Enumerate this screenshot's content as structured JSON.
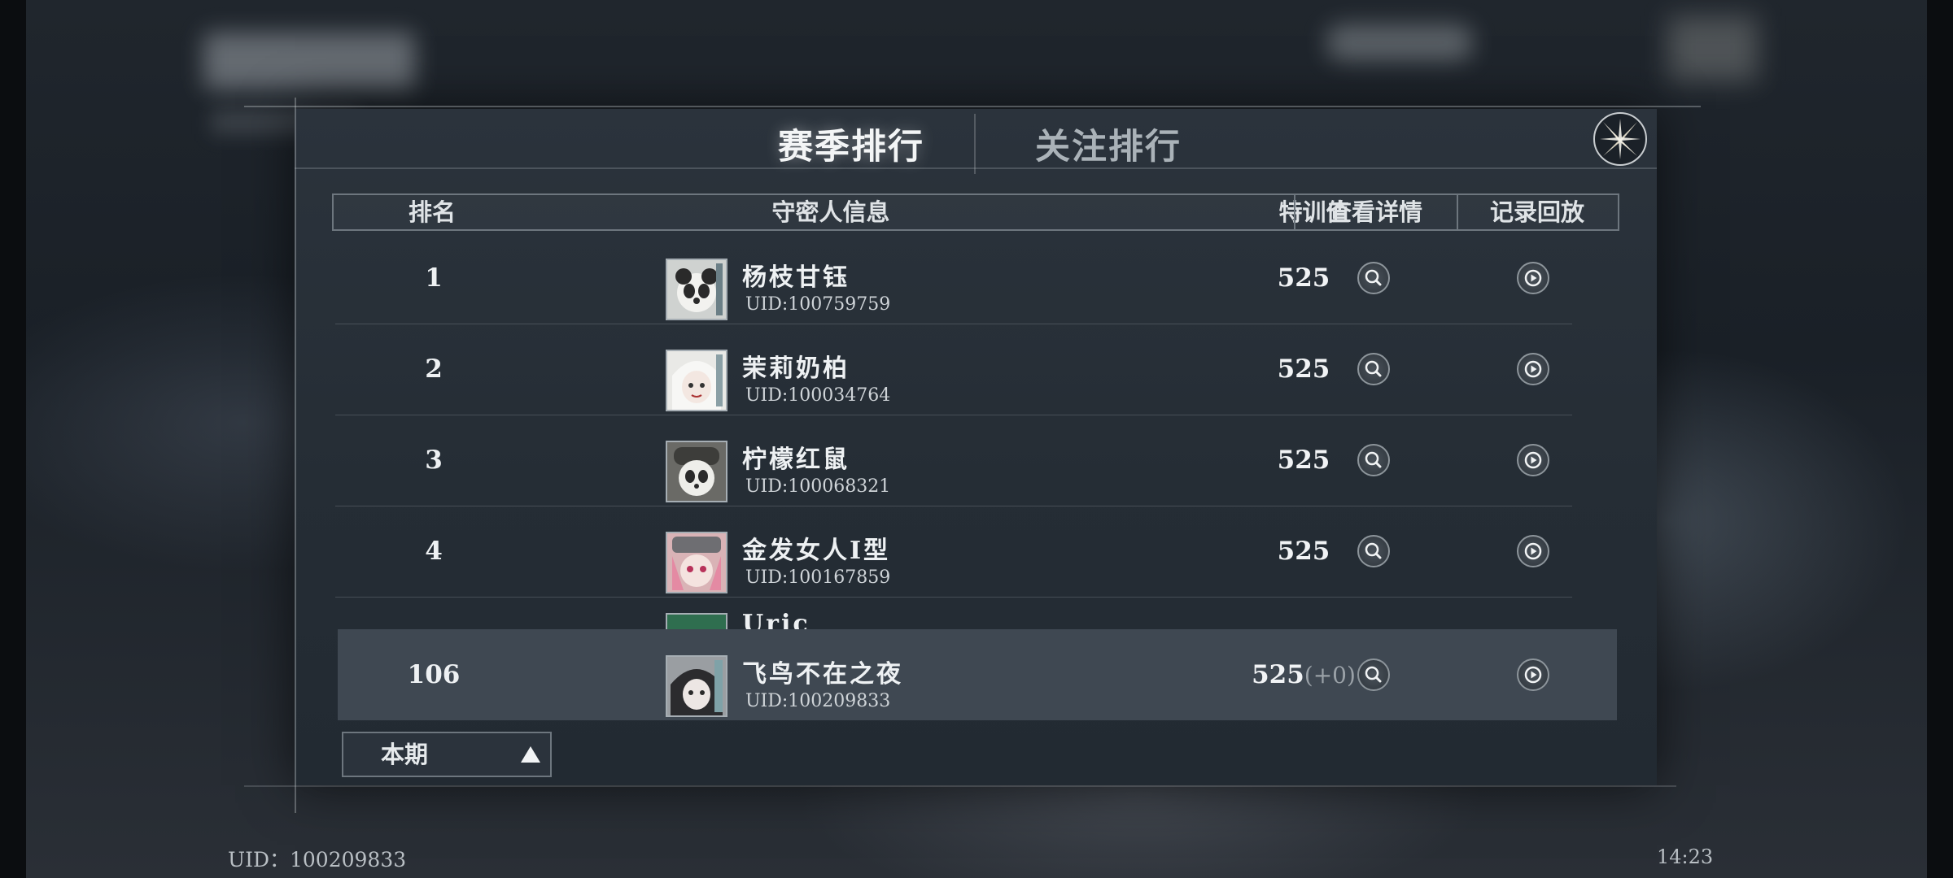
{
  "tabs": {
    "season_label": "赛季排行",
    "follow_label": "关注排行"
  },
  "table": {
    "headers": [
      "排名",
      "守密人信息",
      "特训值",
      "查看详情",
      "记录回放"
    ],
    "rows": [
      {
        "rank": "1",
        "name": "杨枝甘钰",
        "uid": "UID:100759759",
        "score": "525"
      },
      {
        "rank": "2",
        "name": "茉莉奶柏",
        "uid": "UID:100034764",
        "score": "525"
      },
      {
        "rank": "3",
        "name": "柠檬红鼠",
        "uid": "UID:100068321",
        "score": "525"
      },
      {
        "rank": "4",
        "name": "金发女人I型",
        "uid": "UID:100167859",
        "score": "525"
      }
    ],
    "partial_row_name": "Uric"
  },
  "self": {
    "rank": "106",
    "name": "飞鸟不在之夜",
    "uid": "UID:100209833",
    "score": "525",
    "delta": "(+0)"
  },
  "period_select": {
    "value": "本期"
  },
  "footer": {
    "uid": "UID：100209833",
    "time": "14:23"
  },
  "icons": {
    "close": "close-x-icon",
    "detail": "magnifier-icon",
    "replay": "play-circle-icon",
    "dropdown": "triangle-up-icon"
  }
}
